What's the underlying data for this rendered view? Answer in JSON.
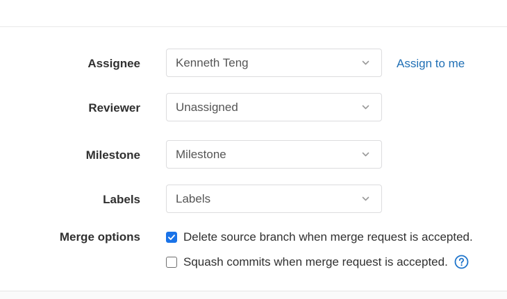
{
  "assignee": {
    "label": "Assignee",
    "value": "Kenneth Teng",
    "assign_to_me": "Assign to me"
  },
  "reviewer": {
    "label": "Reviewer",
    "value": "Unassigned"
  },
  "milestone": {
    "label": "Milestone",
    "value": "Milestone"
  },
  "labels": {
    "label": "Labels",
    "value": "Labels"
  },
  "merge_options": {
    "label": "Merge options",
    "delete_source_branch": {
      "text": "Delete source branch when merge request is accepted.",
      "checked": true
    },
    "squash_commits": {
      "text": "Squash commits when merge request is accepted.",
      "checked": false
    }
  },
  "icons": {
    "dropdown": "chevron-down-icon",
    "help": "question-circle-icon",
    "checkmark": "checkmark-icon"
  },
  "colors": {
    "link": "#1f6fb5",
    "checkbox_checked": "#1a73e8",
    "help_icon": "#1f75cb"
  }
}
